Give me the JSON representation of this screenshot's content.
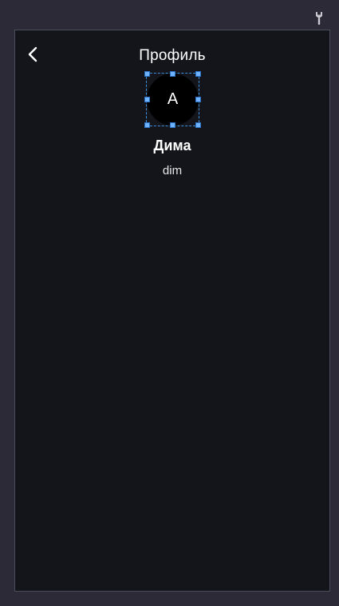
{
  "editor": {
    "tool_icon": "wrench-icon"
  },
  "header": {
    "back_icon": "chevron-left-icon",
    "title": "Профиль"
  },
  "profile": {
    "avatar_letter": "A",
    "name": "Дима",
    "username": "dim"
  },
  "colors": {
    "editor_background": "#2b2a36",
    "screen_background": "#13151b",
    "text_primary": "#ffffff",
    "avatar_background": "#000000",
    "selection": "#3d8fe0"
  }
}
